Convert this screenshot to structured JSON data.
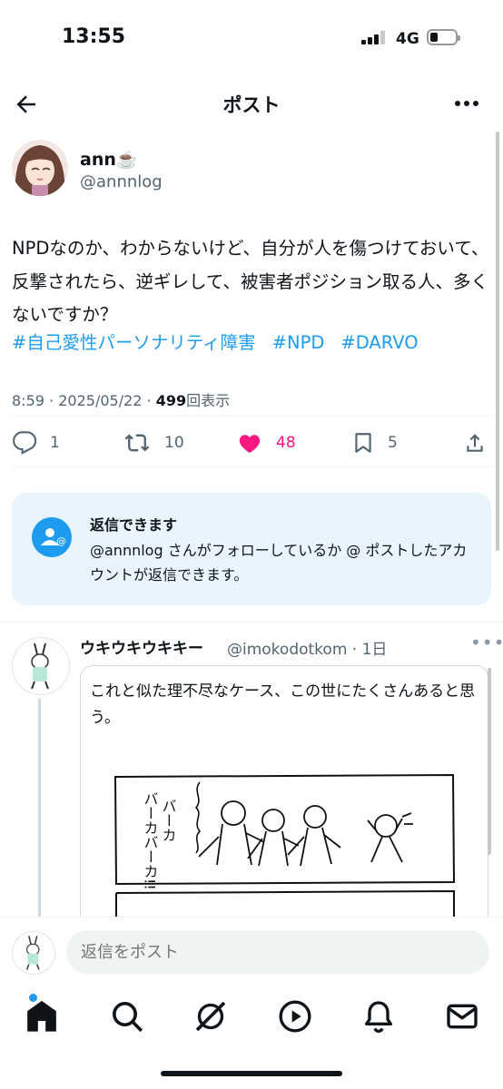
{
  "status_bar": {
    "time": "13:55",
    "network": "4G",
    "battery_level": 0.3
  },
  "header": {
    "title": "ポスト",
    "back_icon": "arrow-left-icon",
    "more_icon": "more-icon"
  },
  "post": {
    "author": {
      "name": "ann☕️",
      "handle": "@annnlog"
    },
    "text": "NPDなのか、わからないけど、自分が人を傷つけておいて、反撃されたら、逆ギレして、被害者ポジション取る人、多くないですか？",
    "hashtags": [
      "#自己愛性パーソナリティ障害",
      "#NPD",
      "#DARVO"
    ],
    "time": "8:59",
    "date": "2025/05/22",
    "views": "499",
    "views_label": "回表示",
    "separator": "·",
    "actions": {
      "reply_count": "1",
      "retweet_count": "10",
      "like_count": "48",
      "bookmark_count": "5"
    }
  },
  "reply_restriction": {
    "title": "返信できます",
    "body": "@annnlog さんがフォローしているか @ ポストしたアカウントが返信できます。"
  },
  "reply": {
    "name": "ウキウキウキキー",
    "handle": "@imokodotkom",
    "age": "· 1日",
    "text": "これと似た理不尽なケース、この世にたくさんあると思う。",
    "manga_text_1": "バーカ",
    "manga_text_2": "バーカバーカ!!",
    "manga_text_3": "バ"
  },
  "composer": {
    "placeholder": "返信をポスト"
  },
  "tabbar": {
    "icons": [
      "home-icon",
      "search-icon",
      "grok-icon",
      "video-icon",
      "notifications-icon",
      "messages-icon"
    ]
  },
  "colors": {
    "accent": "#1d9bf0",
    "like": "#f91880",
    "text": "#0f1419",
    "secondary": "#536471"
  }
}
